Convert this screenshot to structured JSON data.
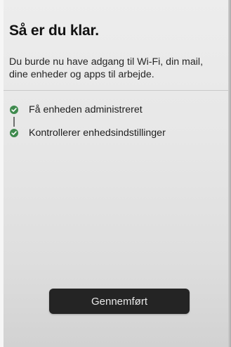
{
  "screen": {
    "title": "Så er du klar.",
    "description": "Du burde nu have adgang til Wi-Fi, din mail, dine enheder og apps til arbejde."
  },
  "steps": [
    {
      "label": "Få enheden administreret",
      "status": "done",
      "icon": "check-circle-icon"
    },
    {
      "label": "Kontrollerer enhedsindstillinger",
      "status": "done",
      "icon": "check-circle-icon"
    }
  ],
  "button": {
    "label": "Gennemført"
  },
  "colors": {
    "check_green": "#3f8a4e",
    "button_bg": "#242424",
    "button_text": "#e8e8e8"
  }
}
